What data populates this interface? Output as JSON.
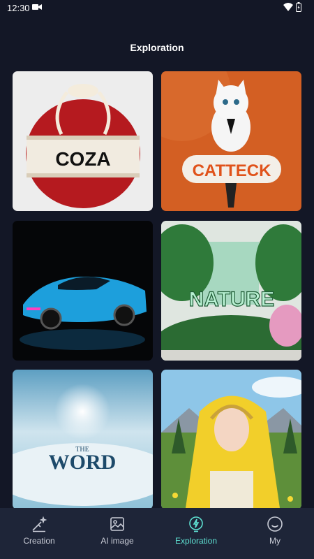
{
  "status_bar": {
    "time": "12:30"
  },
  "header": {
    "title": "Exploration"
  },
  "gallery": {
    "cards": [
      {
        "text": "COZA"
      },
      {
        "text": "CATTECK"
      },
      {
        "text": ""
      },
      {
        "text": "NATURE"
      },
      {
        "text_small": "THE",
        "text": "WORD"
      },
      {
        "text": ""
      }
    ]
  },
  "tabbar": {
    "tabs": [
      {
        "label": "Creation",
        "icon": "magic-wand-icon"
      },
      {
        "label": "AI image",
        "icon": "image-icon"
      },
      {
        "label": "Exploration",
        "icon": "bolt-icon"
      },
      {
        "label": "My",
        "icon": "smile-icon"
      }
    ],
    "active_tab": "Exploration",
    "active_color": "#5ee0d1"
  }
}
